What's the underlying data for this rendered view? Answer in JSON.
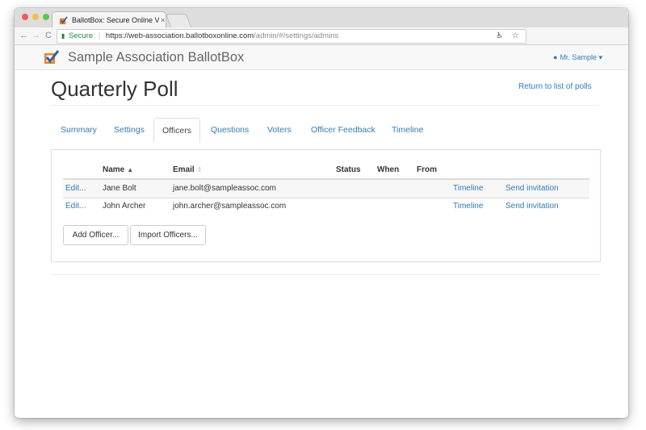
{
  "browser": {
    "tab_title": "BallotBox: Secure Online Votin",
    "tab_close": "×",
    "secure_label": "Secure",
    "url_main": "https://web-association.ballotboxonline.com",
    "url_path": "/admin/#/settings/admins"
  },
  "app": {
    "title": "Sample Association BallotBox",
    "user_name": "Mr. Sample",
    "accent_color": "#337ab7"
  },
  "page": {
    "title": "Quarterly Poll",
    "return_link": "Return to list of polls"
  },
  "tabs": [
    {
      "label": "Summary",
      "active": false
    },
    {
      "label": "Settings",
      "active": false
    },
    {
      "label": "Officers",
      "active": true
    },
    {
      "label": "Questions",
      "active": false
    },
    {
      "label": "Voters",
      "active": false
    },
    {
      "label": "Officer Feedback",
      "active": false
    },
    {
      "label": "Timeline",
      "active": false
    }
  ],
  "table": {
    "columns": [
      "Name",
      "Email",
      "Status",
      "When",
      "From"
    ],
    "sort_asc_icon": "▲",
    "sort_both_icon": "⇕",
    "rows": [
      {
        "edit": "Edit...",
        "name": "Jane Bolt",
        "email": "jane.bolt@sampleassoc.com",
        "status": "",
        "when": "",
        "from": "",
        "timeline": "Timeline",
        "invite": "Send invitation"
      },
      {
        "edit": "Edit...",
        "name": "John Archer",
        "email": "john.archer@sampleassoc.com",
        "status": "",
        "when": "",
        "from": "",
        "timeline": "Timeline",
        "invite": "Send invitation"
      }
    ]
  },
  "buttons": {
    "add_officer": "Add Officer...",
    "import_officers": "Import Officers..."
  }
}
